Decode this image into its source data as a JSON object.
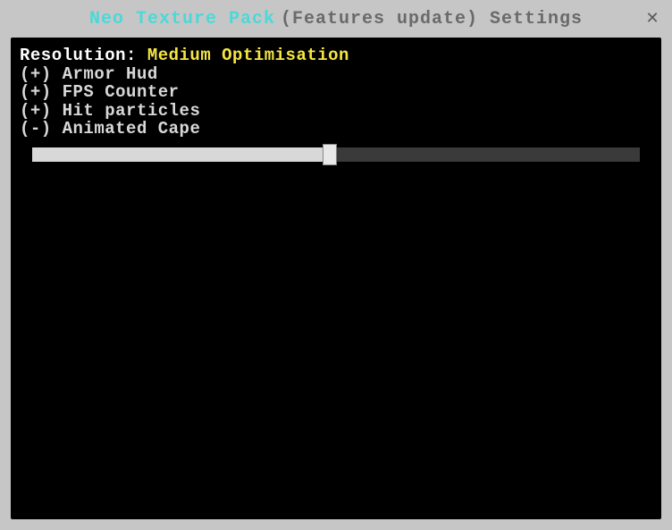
{
  "titlebar": {
    "brand": "Neo Texture Pack",
    "suffix": "(Features update) Settings",
    "close_glyph": "✕"
  },
  "resolution": {
    "label": "Resolution: ",
    "value": "Medium Optimisation"
  },
  "features": [
    {
      "marker": "(+)",
      "name": "Armor Hud"
    },
    {
      "marker": "(+)",
      "name": "FPS Counter"
    },
    {
      "marker": "(+)",
      "name": "Hit particles"
    },
    {
      "marker": "(-)",
      "name": "Animated Cape"
    }
  ],
  "slider": {
    "percent": 49
  }
}
